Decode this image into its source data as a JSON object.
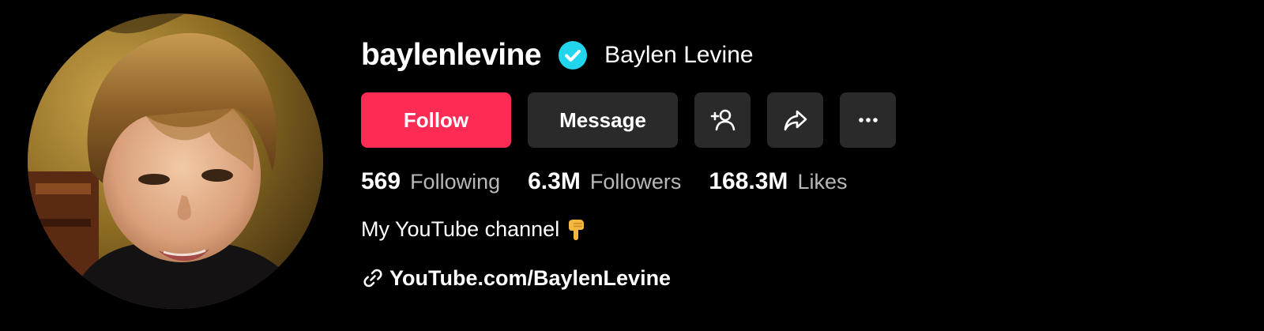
{
  "profile": {
    "username": "baylenlevine",
    "display_name": "Baylen Levine",
    "verified": true,
    "verified_icon": "verified-check-icon",
    "avatar_icon": "avatar-photo"
  },
  "actions": {
    "follow_label": "Follow",
    "message_label": "Message",
    "add_friend_icon": "add-user-icon",
    "share_icon": "share-arrow-icon",
    "more_icon": "more-dots-icon"
  },
  "stats": [
    {
      "value": "569",
      "label": "Following"
    },
    {
      "value": "6.3M",
      "label": "Followers"
    },
    {
      "value": "168.3M",
      "label": "Likes"
    }
  ],
  "bio": {
    "text": "My YouTube channel",
    "emoji_icon": "pointing-down-hand-emoji"
  },
  "link": {
    "icon": "link-icon",
    "text": "YouTube.com/BaylenLevine"
  },
  "colors": {
    "background": "#000000",
    "follow_button": "#fe2c55",
    "secondary_button": "#2a2a2a",
    "verified_badge": "#20d5ec",
    "muted_text": "#b8b8b8"
  }
}
